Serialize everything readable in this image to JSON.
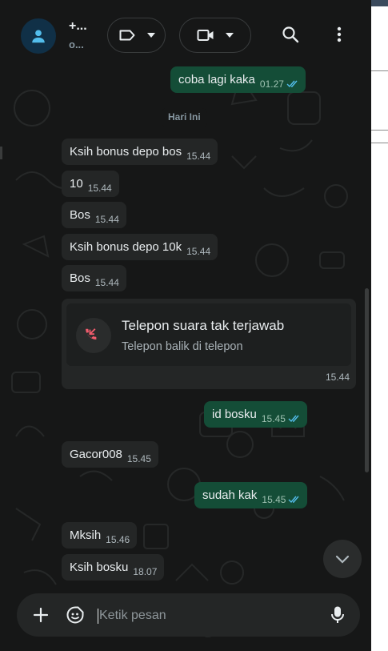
{
  "header": {
    "contact_name": "+...",
    "contact_sub": "o...",
    "label_icon": "label-icon",
    "video_icon": "video-call-icon",
    "search_icon": "search-icon",
    "menu_icon": "more-vert-icon"
  },
  "messages": [
    {
      "dir": "out",
      "text": "coba lagi kaka",
      "time": "01.27",
      "read": true
    },
    {
      "dir": "sep",
      "text": "Hari Ini"
    },
    {
      "dir": "in",
      "text": "Ksih bonus depo bos",
      "time": "15.44"
    },
    {
      "dir": "in",
      "text": "10",
      "time": "15.44"
    },
    {
      "dir": "in",
      "text": "Bos",
      "time": "15.44"
    },
    {
      "dir": "in",
      "text": "Ksih bonus depo 10k",
      "time": "15.44"
    },
    {
      "dir": "in",
      "text": "Bos",
      "time": "15.44"
    },
    {
      "dir": "call",
      "title": "Telepon suara tak terjawab",
      "sub": "Telepon balik di telepon",
      "time": "15.44"
    },
    {
      "dir": "out",
      "text": "id bosku",
      "time": "15.45",
      "read": true
    },
    {
      "dir": "in",
      "text": "Gacor008",
      "time": "15.45"
    },
    {
      "dir": "out",
      "text": "sudah kak",
      "time": "15.45",
      "read": true
    },
    {
      "dir": "in",
      "text": "Mksih",
      "time": "15.46"
    },
    {
      "dir": "in",
      "text": "Ksih bosku",
      "time": "18.07"
    }
  ],
  "composer": {
    "placeholder": "Ketik pesan",
    "attach_icon": "plus-icon",
    "sticker_icon": "sticker-icon",
    "mic_icon": "mic-icon"
  },
  "colors": {
    "background": "#161717",
    "incoming": "#242626",
    "outgoing": "#144d37",
    "read_ticks": "#53bdeb",
    "missed_call": "#f15c6d"
  }
}
